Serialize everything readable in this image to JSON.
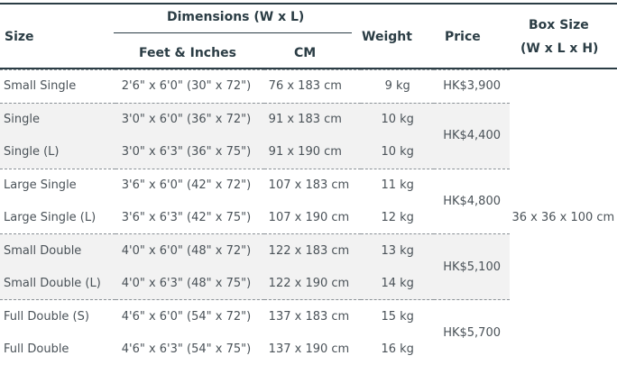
{
  "headers": {
    "size": "Size",
    "dimensions": "Dimensions (W x L)",
    "feet_inches": "Feet & Inches",
    "cm": "CM",
    "weight": "Weight",
    "price": "Price",
    "box_size_line1": "Box Size",
    "box_size_line2": "(W x L x H)"
  },
  "box_size": "36 x 36 x 100 cm",
  "rows": [
    {
      "size": "Small Single",
      "feet": "2'6\" x 6'0\"  (30\" x 72\")",
      "cm": "76 x 183 cm",
      "weight": "9 kg"
    },
    {
      "size": "Single",
      "feet": "3'0\" x 6'0\"  (36\" x 72\")",
      "cm": "91 x 183 cm",
      "weight": "10 kg"
    },
    {
      "size": "Single (L)",
      "feet": "3'0\" x 6'3\"  (36\" x 75\")",
      "cm": "91 x 190 cm",
      "weight": "10 kg"
    },
    {
      "size": "Large Single",
      "feet": "3'6\" x 6'0\"  (42\" x 72\")",
      "cm": "107 x 183 cm",
      "weight": "11 kg"
    },
    {
      "size": "Large Single (L)",
      "feet": "3'6\" x 6'3\"  (42\" x 75\")",
      "cm": "107 x 190 cm",
      "weight": "12 kg"
    },
    {
      "size": "Small Double",
      "feet": "4'0\" x 6'0\"  (48\" x 72\")",
      "cm": "122 x 183 cm",
      "weight": "13 kg"
    },
    {
      "size": "Small Double (L)",
      "feet": "4'0\" x 6'3\"  (48\" x 75\")",
      "cm": "122 x 190 cm",
      "weight": "14 kg"
    },
    {
      "size": "Full Double (S)",
      "feet": "4'6\" x 6'0\"  (54\" x 72\")",
      "cm": "137 x 183 cm",
      "weight": "15 kg"
    },
    {
      "size": "Full Double",
      "feet": "4'6\" x 6'3\"  (54\" x 75\")",
      "cm": "137 x 190 cm",
      "weight": "16 kg"
    }
  ],
  "prices": [
    "HK$3,900",
    "HK$4,400",
    "HK$4,800",
    "HK$5,100",
    "HK$5,700"
  ]
}
